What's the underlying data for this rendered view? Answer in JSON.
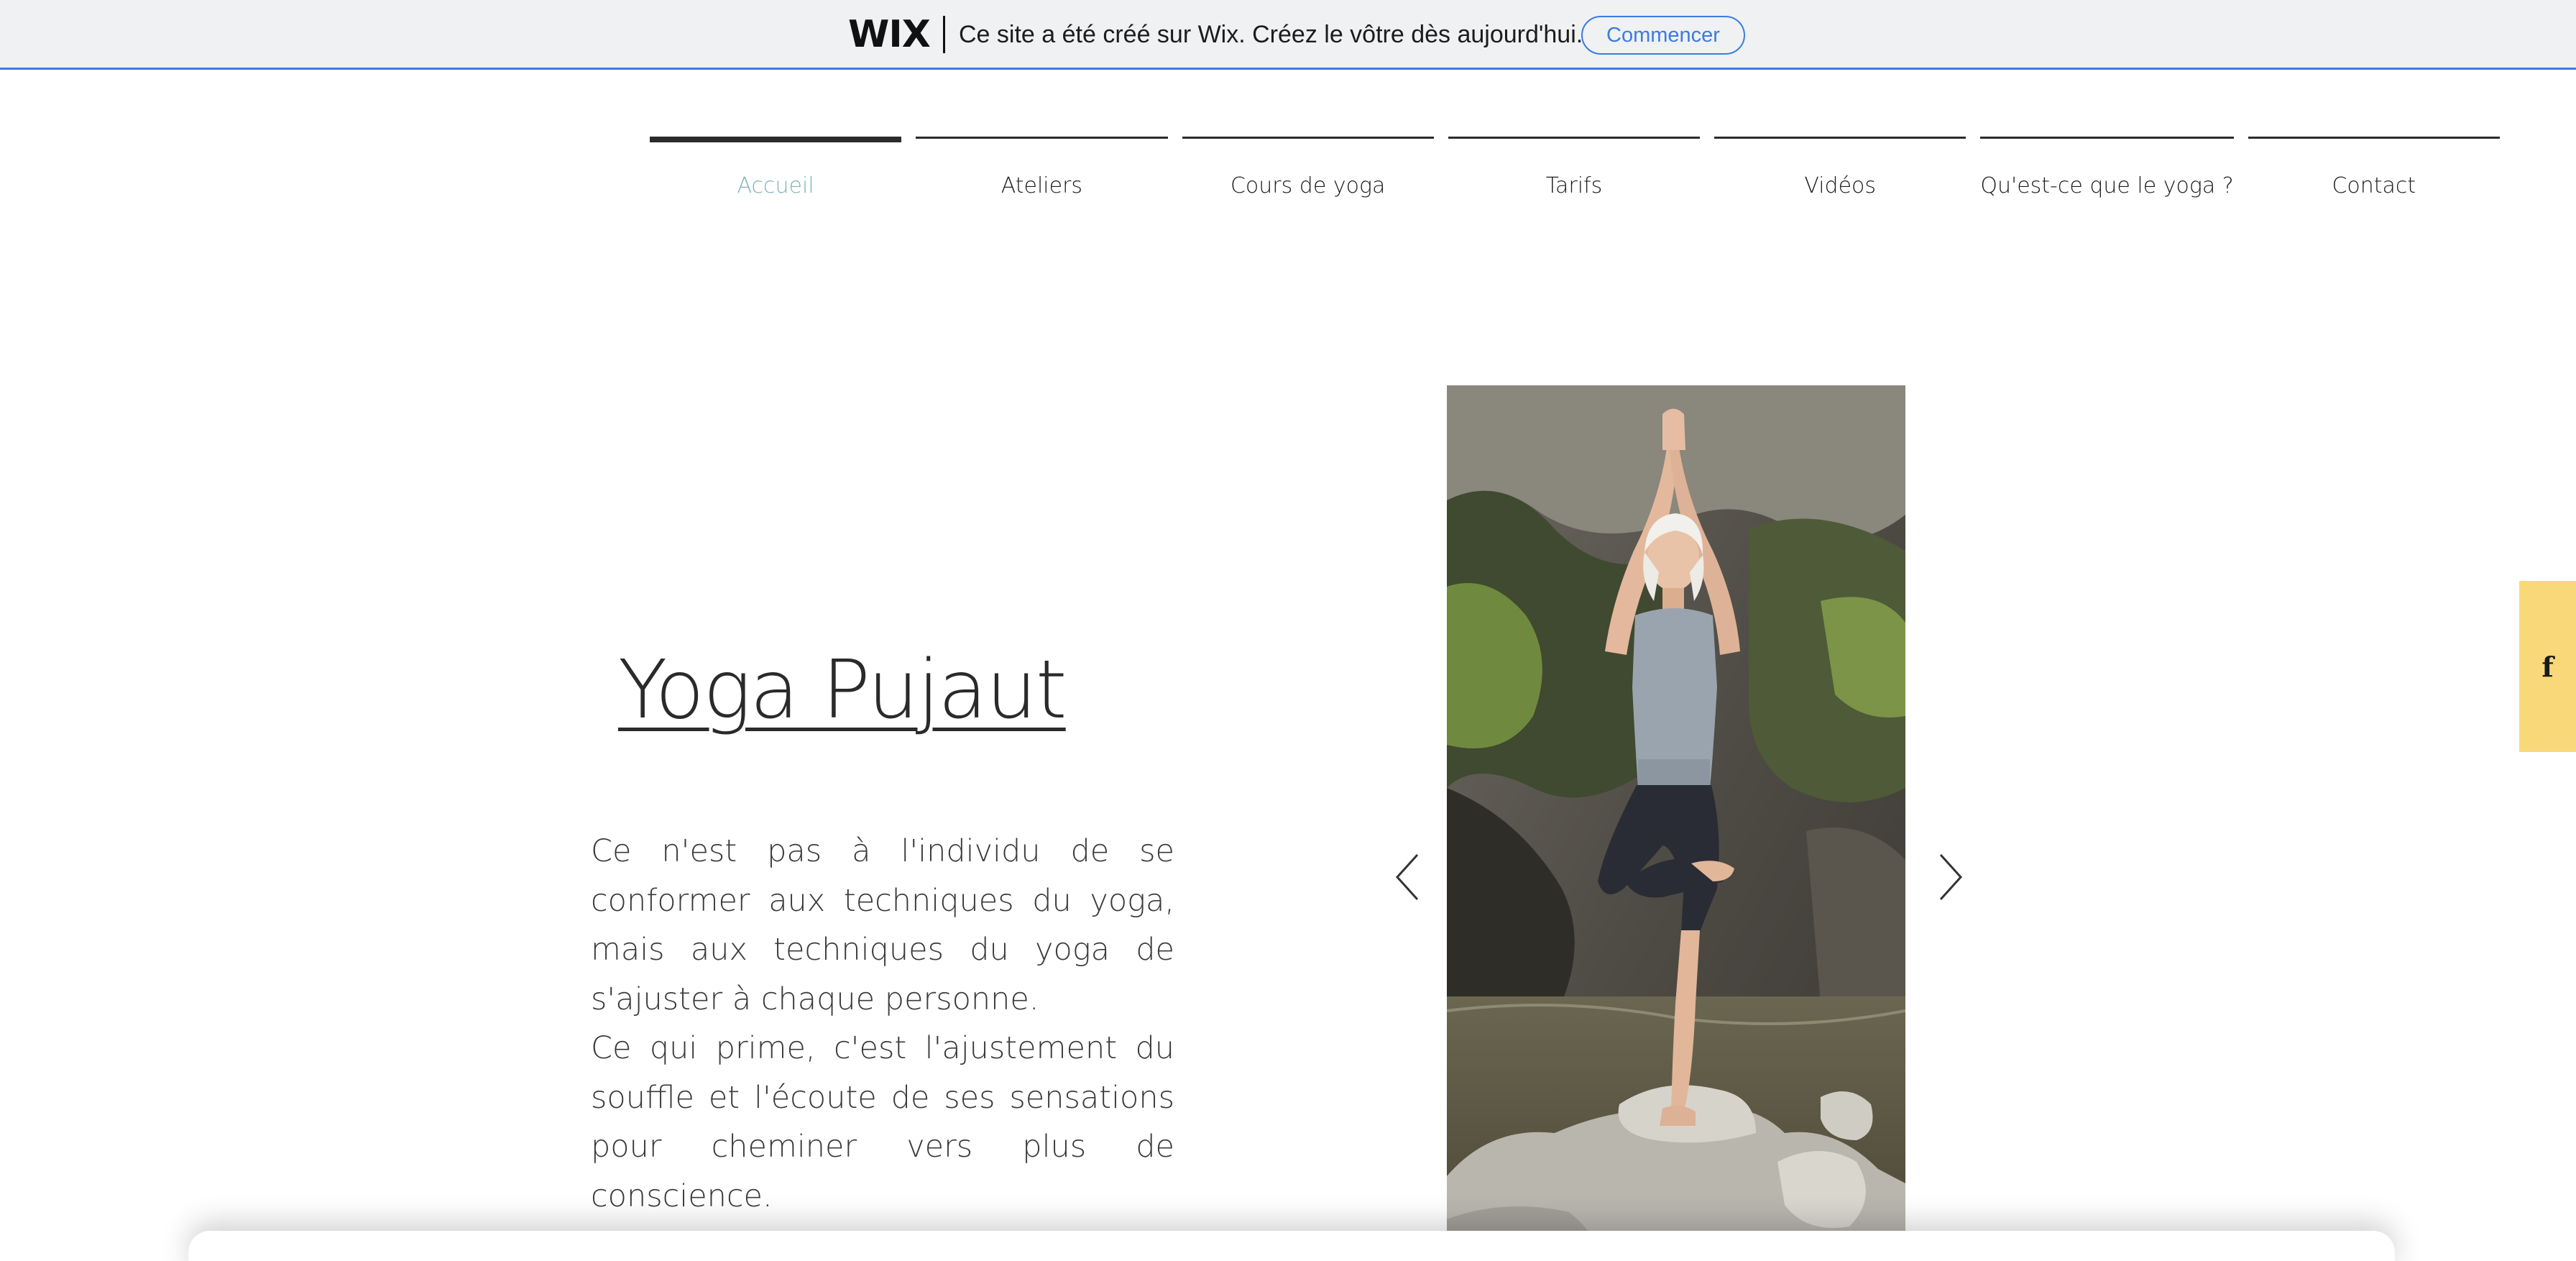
{
  "banner": {
    "logo": "WIX",
    "message": "Ce site a été créé sur Wix. Créez le vôtre dès aujourd'hui.",
    "cta_label": "Commencer",
    "accent_color": "#3b7be0"
  },
  "nav": {
    "items": [
      {
        "label": "Accueil",
        "active": true
      },
      {
        "label": "Ateliers"
      },
      {
        "label": "Cours de yoga"
      },
      {
        "label": "Tarifs"
      },
      {
        "label": "Vidéos"
      },
      {
        "label": "Qu'est-ce que le yoga ?"
      },
      {
        "label": "Contact"
      }
    ],
    "active_color": "#7fb3b8"
  },
  "hero": {
    "title": "Yoga Pujaut",
    "paragraph_1": "Ce n'est pas à l'individu de se conformer aux techniques du yoga, mais aux techniques du yoga de s'ajuster à chaque personne.",
    "paragraph_2": "Ce qui prime, c'est l'ajustement du souffle et l'écoute de ses sensations pour cheminer vers plus de conscience."
  },
  "slideshow": {
    "prev_icon": "chevron-left-icon",
    "next_icon": "chevron-right-icon"
  },
  "social": {
    "facebook_glyph": "f",
    "tab_color": "#f9d879"
  }
}
